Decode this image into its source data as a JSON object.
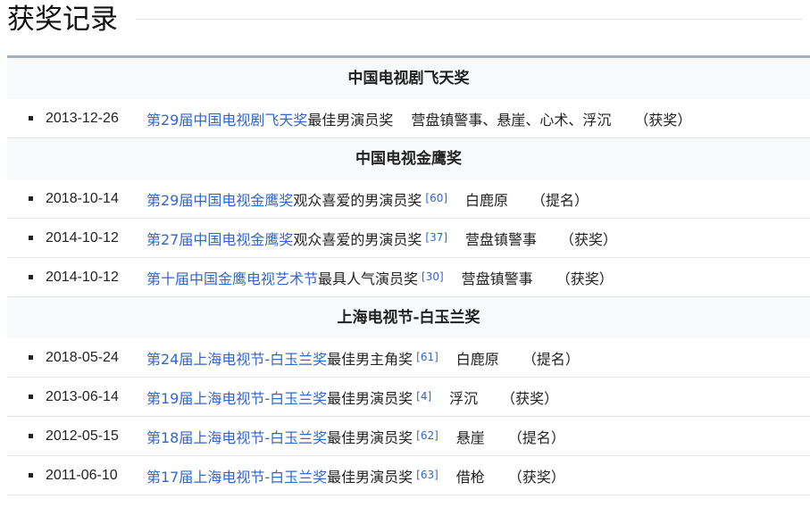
{
  "page": {
    "title": "获奖记录"
  },
  "sections": [
    {
      "heading": "中国电视剧飞天奖",
      "rows": [
        {
          "date": "2013-12-26",
          "link": "第29届中国电视剧飞天奖",
          "award": "最佳男演员奖",
          "ref": "",
          "work": "营盘镇警事、悬崖、心术、浮沉",
          "result": "（获奖）"
        }
      ]
    },
    {
      "heading": "中国电视金鹰奖",
      "rows": [
        {
          "date": "2018-10-14",
          "link": "第29届中国电视金鹰奖",
          "award": "观众喜爱的男演员奖",
          "ref": "[60]",
          "work": "白鹿原",
          "result": "（提名）"
        },
        {
          "date": "2014-10-12",
          "link": "第27届中国电视金鹰奖",
          "award": "观众喜爱的男演员奖",
          "ref": "[37]",
          "work": "营盘镇警事",
          "result": "（获奖）"
        },
        {
          "date": "2014-10-12",
          "link": "第十届中国金鹰电视艺术节",
          "award": "最具人气演员奖",
          "ref": "[30]",
          "work": "营盘镇警事",
          "result": "（获奖）"
        }
      ]
    },
    {
      "heading": "上海电视节-白玉兰奖",
      "rows": [
        {
          "date": "2018-05-24",
          "link": "第24届上海电视节-白玉兰奖",
          "award": "最佳男主角奖",
          "ref": "[61]",
          "work": "白鹿原",
          "result": "（提名）"
        },
        {
          "date": "2013-06-14",
          "link": "第19届上海电视节-白玉兰奖",
          "award": "最佳男演员奖",
          "ref": "[4]",
          "work": "浮沉",
          "result": "（获奖）"
        },
        {
          "date": "2012-05-15",
          "link": "第18届上海电视节-白玉兰奖",
          "award": "最佳男演员奖",
          "ref": "[62]",
          "work": "悬崖",
          "result": "（提名）"
        },
        {
          "date": "2011-06-10",
          "link": "第17届上海电视节-白玉兰奖",
          "award": "最佳男演员奖",
          "ref": "[63]",
          "work": "借枪",
          "result": "（获奖）"
        }
      ]
    }
  ]
}
